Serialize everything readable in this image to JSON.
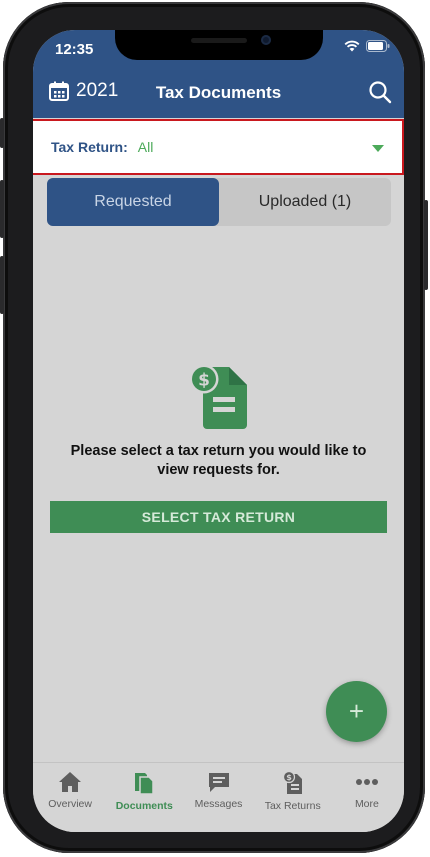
{
  "status_bar": {
    "time": "12:35"
  },
  "header": {
    "year": "2021",
    "title": "Tax Documents"
  },
  "selector": {
    "label": "Tax Return:",
    "value": "All"
  },
  "tabs": [
    {
      "label": "Requested",
      "active": true
    },
    {
      "label": "Uploaded (1)",
      "active": false
    }
  ],
  "empty_state": {
    "message": "Please select a tax return you would like to view requests for.",
    "button_label": "SELECT TAX RETURN"
  },
  "fab": {
    "label": "+"
  },
  "bottom_nav": [
    {
      "label": "Overview",
      "icon": "home-icon",
      "active": false
    },
    {
      "label": "Documents",
      "icon": "documents-icon",
      "active": true
    },
    {
      "label": "Messages",
      "icon": "messages-icon",
      "active": false
    },
    {
      "label": "Tax Returns",
      "icon": "tax-returns-icon",
      "active": false
    },
    {
      "label": "More",
      "icon": "more-icon",
      "active": false
    }
  ],
  "colors": {
    "brand_blue": "#2f5386",
    "accent_green": "#3f8d55",
    "highlight_red": "#c9181e"
  }
}
